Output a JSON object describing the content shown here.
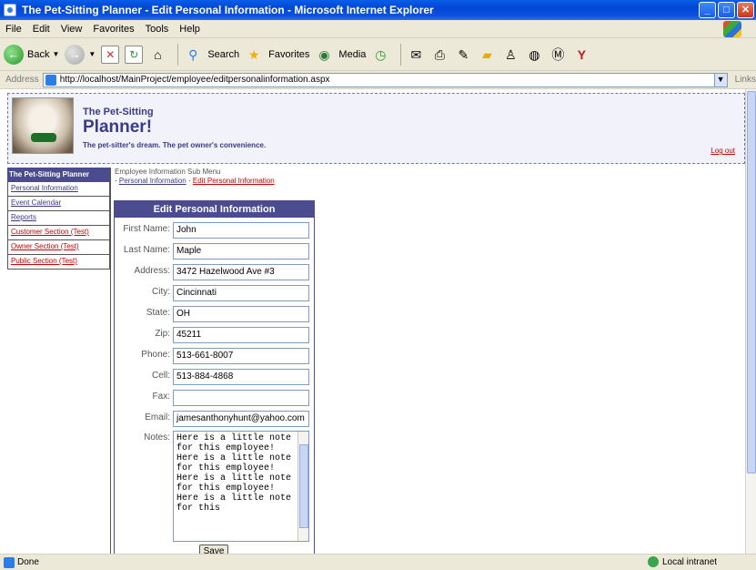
{
  "window": {
    "title": "The Pet-Sitting Planner - Edit Personal Information - Microsoft Internet Explorer"
  },
  "menubar": [
    "File",
    "Edit",
    "View",
    "Favorites",
    "Tools",
    "Help"
  ],
  "toolbar": {
    "back": "Back",
    "search": "Search",
    "favorites": "Favorites",
    "media": "Media"
  },
  "addressbar": {
    "label": "Address",
    "url": "http://localhost/MainProject/employee/editpersonalinformation.aspx",
    "links": "Links"
  },
  "header": {
    "brand_small": "The Pet-Sitting",
    "brand_big": "Planner!",
    "tagline": "The pet-sitter's dream. The pet owner's convenience.",
    "logout": "Log out"
  },
  "sidebar": {
    "title": "The Pet-Sitting Planner",
    "items": [
      {
        "label": "Personal Information"
      },
      {
        "label": "Event Calendar"
      },
      {
        "label": "Reports"
      },
      {
        "label": "Customer Section (Test)"
      },
      {
        "label": "Owner Section (Test)"
      },
      {
        "label": "Public Section (Test)"
      }
    ]
  },
  "submenu": {
    "title": "Employee Information Sub Menu",
    "bullet": "·",
    "link1": "Personal Information",
    "link2": "Edit Personal Information"
  },
  "form": {
    "title": "Edit Personal Information",
    "fields": [
      {
        "label": "First Name:",
        "value": "John"
      },
      {
        "label": "Last Name:",
        "value": "Maple"
      },
      {
        "label": "Address:",
        "value": "3472 Hazelwood Ave #3"
      },
      {
        "label": "City:",
        "value": "Cincinnati"
      },
      {
        "label": "State:",
        "value": "OH"
      },
      {
        "label": "Zip:",
        "value": "45211"
      },
      {
        "label": "Phone:",
        "value": "513-661-8007"
      },
      {
        "label": "Cell:",
        "value": "513-884-4868"
      },
      {
        "label": "Fax:",
        "value": ""
      },
      {
        "label": "Email:",
        "value": "jamesanthonyhunt@yahoo.com"
      }
    ],
    "notes_label": "Notes:",
    "notes_value": "Here is a little note for this employee! Here is a little note for this employee! Here is a little note for this employee! Here is a little note for this",
    "save_label": "Save"
  },
  "statusbar": {
    "status": "Done",
    "zone": "Local intranet"
  }
}
